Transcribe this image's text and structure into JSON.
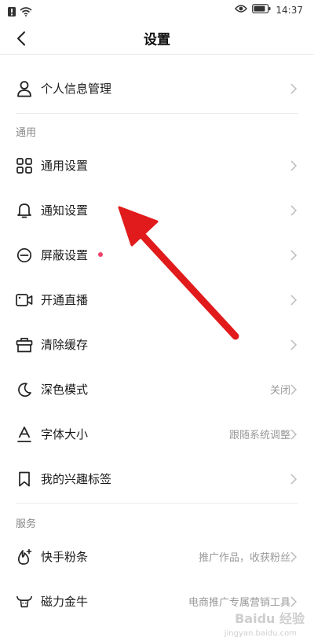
{
  "status_bar": {
    "time": "14:37"
  },
  "header": {
    "title": "设置"
  },
  "profile": {
    "label": "个人信息管理"
  },
  "sections": {
    "general": {
      "title": "通用",
      "items": [
        {
          "label": "通用设置",
          "value": ""
        },
        {
          "label": "通知设置",
          "value": ""
        },
        {
          "label": "屏蔽设置",
          "value": ""
        },
        {
          "label": "开通直播",
          "value": ""
        },
        {
          "label": "清除缓存",
          "value": ""
        },
        {
          "label": "深色模式",
          "value": "关闭"
        },
        {
          "label": "字体大小",
          "value": "跟随系统调整"
        },
        {
          "label": "我的兴趣标签",
          "value": ""
        }
      ]
    },
    "services": {
      "title": "服务",
      "items": [
        {
          "label": "快手粉条",
          "value": "推广作品，收获粉丝"
        },
        {
          "label": "磁力金牛",
          "value": "电商推广专属营销工具"
        }
      ]
    }
  },
  "watermark": {
    "text": "Baidu 经验",
    "sub": "jingyan.baidu.com"
  },
  "colors": {
    "accent_dot": "#f0436a",
    "arrow": "#e11b1b"
  }
}
